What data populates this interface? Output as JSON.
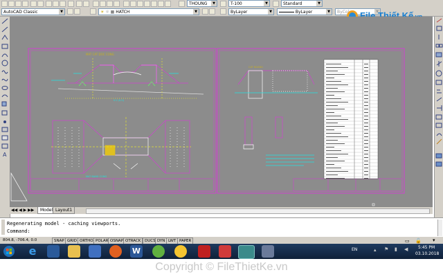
{
  "toolbar": {
    "workspace": "AutoCAD Classic",
    "layer": "HATCH",
    "linetype_style": "THOUNG",
    "dim_style": "T-100",
    "style_standard": "Standard",
    "color": "ByLayer",
    "linetype": "ByLayer",
    "lineweight": "ByColor"
  },
  "watermark": {
    "brand": "File Thiết Kế",
    "suffix": ".vn"
  },
  "tabs": {
    "model": "Model",
    "layout1": "Layout1"
  },
  "command": {
    "history": "Regenerating model - caching viewports.",
    "prompt": "Command:"
  },
  "status": {
    "coords": "804.8, -706.4, 0.0",
    "buttons": [
      "SNAP",
      "GRID",
      "ORTHO",
      "POLAR",
      "OSNAP",
      "OTRACK",
      "DUCS",
      "DYN",
      "LWT",
      "PAPER"
    ]
  },
  "taskbar": {
    "lang": "EN",
    "time": "5:45 PM",
    "date": "03.10.2018"
  },
  "footer": {
    "copyright": "Copyright © FileThietKe.vn"
  }
}
